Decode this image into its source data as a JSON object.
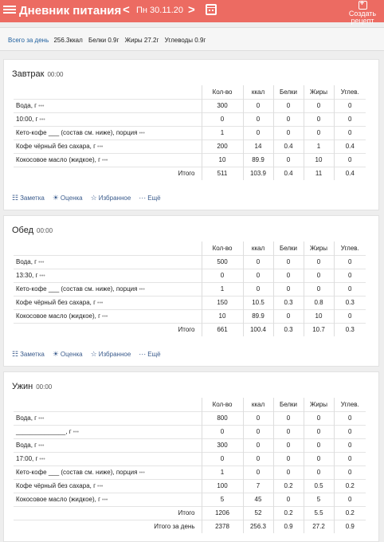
{
  "header": {
    "title": "Дневник питания",
    "prev": "<",
    "date": "Пн 30.11.20",
    "next": ">",
    "create_line1": "Создать",
    "create_line2": "рецепт"
  },
  "summary": {
    "label": "Всего за день",
    "kcal": "256.3ккал",
    "protein": "Белки 0.9г",
    "fat": "Жиры 27.2г",
    "carbs": "Углеводы 0.9г"
  },
  "columns": [
    "Кол-во",
    "ккал",
    "Белки",
    "Жиры",
    "Углев."
  ],
  "actions": {
    "note": "Заметка",
    "rating": "Оценка",
    "favorite": "Избранное",
    "more": "Ещё"
  },
  "meals": [
    {
      "title": "Завтрак",
      "time": "00:00",
      "rows": [
        {
          "name": "Вода, г",
          "dots": "•••",
          "qty": "300",
          "kcal": "0",
          "protein": "0",
          "fat": "0",
          "carbs": "0"
        },
        {
          "name": "10:00, г",
          "dots": "•••",
          "qty": "0",
          "kcal": "0",
          "protein": "0",
          "fat": "0",
          "carbs": "0"
        },
        {
          "name": "Кето-кофе ___ (состав см. ниже), порция",
          "dots": "•••",
          "qty": "1",
          "kcal": "0",
          "protein": "0",
          "fat": "0",
          "carbs": "0"
        },
        {
          "name": "Кофе чёрный без сахара, г",
          "dots": "•••",
          "qty": "200",
          "kcal": "14",
          "protein": "0.4",
          "fat": "1",
          "carbs": "0.4"
        },
        {
          "name": "Кокосовое масло (жидкое), г",
          "dots": "•••",
          "qty": "10",
          "kcal": "89.9",
          "protein": "0",
          "fat": "10",
          "carbs": "0"
        }
      ],
      "total": {
        "label": "Итого",
        "qty": "511",
        "kcal": "103.9",
        "protein": "0.4",
        "fat": "11",
        "carbs": "0.4"
      }
    },
    {
      "title": "Обед",
      "time": "00:00",
      "rows": [
        {
          "name": "Вода, г",
          "dots": "•••",
          "qty": "500",
          "kcal": "0",
          "protein": "0",
          "fat": "0",
          "carbs": "0"
        },
        {
          "name": "13:30, г",
          "dots": "•••",
          "qty": "0",
          "kcal": "0",
          "protein": "0",
          "fat": "0",
          "carbs": "0"
        },
        {
          "name": "Кето-кофе ___ (состав см. ниже), порция",
          "dots": "•••",
          "qty": "1",
          "kcal": "0",
          "protein": "0",
          "fat": "0",
          "carbs": "0"
        },
        {
          "name": "Кофе чёрный без сахара, г",
          "dots": "•••",
          "qty": "150",
          "kcal": "10.5",
          "protein": "0.3",
          "fat": "0.8",
          "carbs": "0.3"
        },
        {
          "name": "Кокосовое масло (жидкое), г",
          "dots": "•••",
          "qty": "10",
          "kcal": "89.9",
          "protein": "0",
          "fat": "10",
          "carbs": "0"
        }
      ],
      "total": {
        "label": "Итого",
        "qty": "661",
        "kcal": "100.4",
        "protein": "0.3",
        "fat": "10.7",
        "carbs": "0.3"
      }
    },
    {
      "title": "Ужин",
      "time": "00:00",
      "rows": [
        {
          "name": "Вода, г",
          "dots": "•••",
          "qty": "800",
          "kcal": "0",
          "protein": "0",
          "fat": "0",
          "carbs": "0"
        },
        {
          "name": "______________, г",
          "dots": "•••",
          "qty": "0",
          "kcal": "0",
          "protein": "0",
          "fat": "0",
          "carbs": "0"
        },
        {
          "name": "Вода, г",
          "dots": "•••",
          "qty": "300",
          "kcal": "0",
          "protein": "0",
          "fat": "0",
          "carbs": "0"
        },
        {
          "name": "17:00, г",
          "dots": "•••",
          "qty": "0",
          "kcal": "0",
          "protein": "0",
          "fat": "0",
          "carbs": "0"
        },
        {
          "name": "Кето-кофе ___ (состав см. ниже), порция",
          "dots": "•••",
          "qty": "1",
          "kcal": "0",
          "protein": "0",
          "fat": "0",
          "carbs": "0"
        },
        {
          "name": "Кофе чёрный без сахара, г",
          "dots": "•••",
          "qty": "100",
          "kcal": "7",
          "protein": "0.2",
          "fat": "0.5",
          "carbs": "0.2"
        },
        {
          "name": "Кокосовое масло (жидкое), г",
          "dots": "•••",
          "qty": "5",
          "kcal": "45",
          "protein": "0",
          "fat": "5",
          "carbs": "0"
        }
      ],
      "total": {
        "label": "Итого",
        "qty": "1206",
        "kcal": "52",
        "protein": "0.2",
        "fat": "5.5",
        "carbs": "0.2"
      },
      "day_total": {
        "label": "Итого за день",
        "qty": "2378",
        "kcal": "256.3",
        "protein": "0.9",
        "fat": "27.2",
        "carbs": "0.9"
      }
    }
  ]
}
